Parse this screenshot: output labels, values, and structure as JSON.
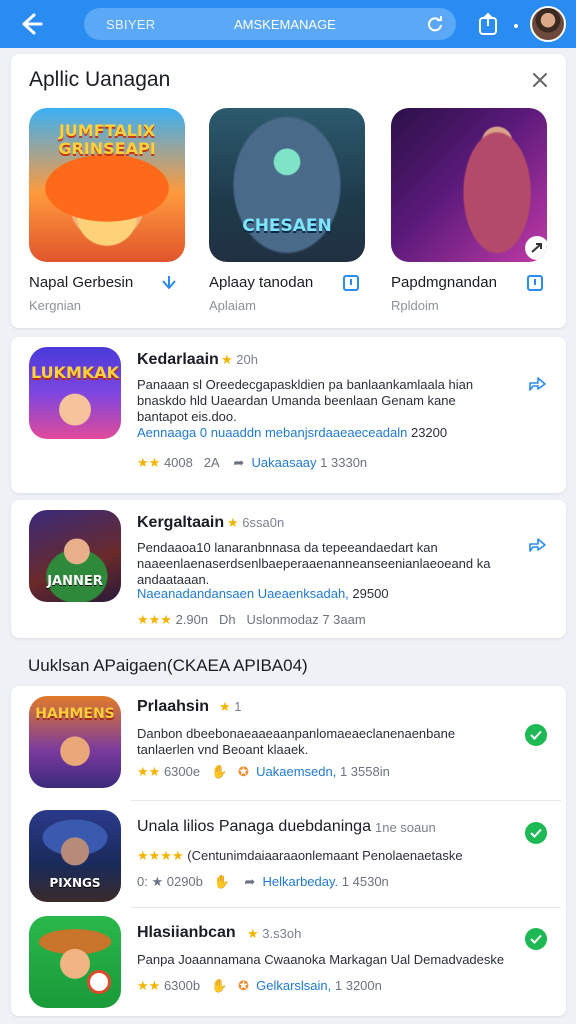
{
  "topbar": {
    "search_placeholder": "SBIYER",
    "search_value": "AMSKEMANAGE",
    "icons": [
      "back-arrow-icon",
      "refresh-icon",
      "share-box-icon",
      "menu-dot-icon"
    ]
  },
  "featured": {
    "title": "Apllic Uanagan",
    "items": [
      {
        "name": "Napal Gerbesin",
        "subtitle": "Kergnian",
        "icon_text": "JUMFTALIX GRINSEAPI"
      },
      {
        "name": "Aplaay tanodan",
        "subtitle": "Aplaiam",
        "icon_text": "CHESAEN"
      },
      {
        "name": "Papdmgnandan",
        "subtitle": "Rpldoim",
        "icon_text": ""
      }
    ]
  },
  "feed": [
    {
      "name": "Kedarlaain",
      "meta": "20h",
      "description": "Panaaan sl Oreedecgapaskldien pa banlaankamlaala hian bnaskdo hld Uaeardan Umanda beenlaan Genam kane bantapot eis.doo.",
      "link": "Aennaaga 0 nuaaddn mebanjsrdaaeaeceadaln",
      "link_number": "23200",
      "rating_text": "4008",
      "comments": "2A",
      "author": "Uakaasaay",
      "author_time": "1 3330n",
      "icon_text": "LUKMKAK"
    },
    {
      "name": "Kergaltaain",
      "meta": "6ssa0n",
      "description": "Pendaaoa10 lanaranbnnasa da tepeeandaedart kan naaeenlaenaserdsenlbaeperaaenanneanseenianlaeoeand ka andaataaan.",
      "link": "Naeanadandansaen Uaeaenksadah,",
      "link_number": "29500",
      "rating_text": "2.90n",
      "comments": "Dh",
      "author": "Uslonmodaz",
      "author_time": "7 3aam",
      "icon_text": "JANNER"
    }
  ],
  "section": {
    "title": "Uuklsan APaigaen(CKAEA APIBA04)",
    "items": [
      {
        "name": "Prlaahsin",
        "meta": "1",
        "description": "Danbon dbeebonaeaaeaanpanlomaeaeclanenaenbane tanlaerlen vnd Beoant klaaek.",
        "rating_text": "6300e",
        "author": "Uakaemsedn,",
        "author_time": "1 3558in",
        "icon_text": "HAHMENS"
      },
      {
        "name": "Unala lilios Panaga duebdaninga",
        "meta": "1ne soaun",
        "description": "(Centunimdaiaaraaonlemaant Penolaenaetaske",
        "rating_text": "0290b",
        "author": "Helkarbeday.",
        "author_time": "1 4530n",
        "icon_text": "PIXNGS"
      },
      {
        "name": "Hlasiianbcan",
        "meta": "3.s3oh",
        "description": "Panpa Joaannamana Cwaanoka Markagan Ual Demadvadeske",
        "rating_text": "6300b",
        "author": "Gelkarslsain,",
        "author_time": "1 3200n",
        "icon_text": ""
      }
    ]
  },
  "colors": {
    "topbar": "#2a8cf0",
    "accent_blue": "#1f7ad6",
    "star": "#f5b400",
    "check_green": "#1db954"
  }
}
